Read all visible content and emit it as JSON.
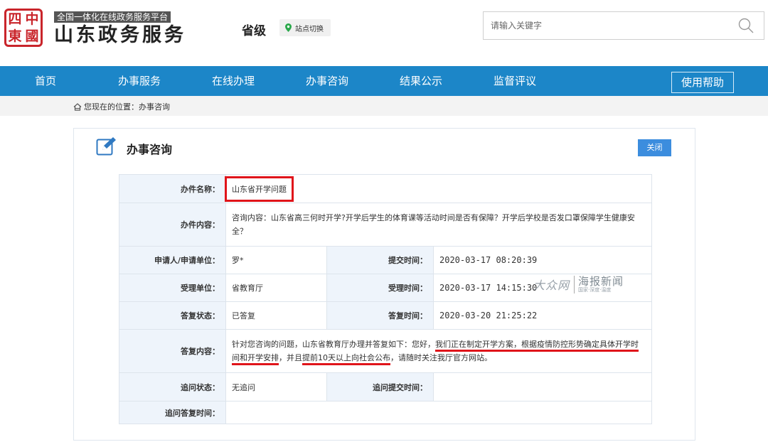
{
  "header": {
    "logo_chars": [
      "四",
      "中",
      "東",
      "國"
    ],
    "platform_tag": "全国一体化在线政务服务平台",
    "site_title": "山东政务服务",
    "level": "省级",
    "switch_label": "站点切换",
    "search_placeholder": "请输入关键字"
  },
  "nav": {
    "items": [
      "首页",
      "办事服务",
      "在线办理",
      "办事咨询",
      "结果公示",
      "监督评议"
    ],
    "help_label": "使用帮助",
    "color": "#1c86c8"
  },
  "breadcrumb": {
    "text": "您现在的位置：办事咨询"
  },
  "panel": {
    "title": "办事咨询",
    "close_label": "关闭"
  },
  "record": {
    "name_label": "办件名称：",
    "name_value": "山东省开学问题",
    "content_label": "办件内容：",
    "content_value": "咨询内容：山东省高三何时开学?开学后学生的体育课等活动时间是否有保障？开学后学校是否发口罩保障学生健康安全？",
    "applicant_label": "申请人/申请单位：",
    "applicant_value": "罗*",
    "submit_time_label": "提交时间：",
    "submit_time_value": "2020-03-17 08:20:39",
    "dept_label": "受理单位：",
    "dept_value": "省教育厅",
    "accept_time_label": "受理时间：",
    "accept_time_value": "2020-03-17 14:15:30",
    "reply_status_label": "答复状态：",
    "reply_status_value": "已答复",
    "reply_time_label": "答复时间：",
    "reply_time_value": "2020-03-20 21:25:22",
    "reply_label": "答复内容：",
    "reply_parts": {
      "p1": "针对您咨询的问题，山东省教育厅办理并答复如下：您好，",
      "p2": "我们正在制定开学方案，根据疫情防控形势确定具体开学时间和开学安排",
      "p3": "，并且",
      "p4": "提前10天以上向社会公布",
      "p5": "，请随时关注我厅官方网站。"
    },
    "followup_status_label": "追问状态：",
    "followup_status_value": "无追问",
    "followup_submit_label": "追问提交时间：",
    "followup_submit_value": "",
    "followup_reply_label": "追问答复时间：",
    "followup_reply_value": ""
  },
  "watermark": {
    "script_text": "大众网",
    "main_text": "海报新闻",
    "sub_text": "国家·深度·温度"
  }
}
